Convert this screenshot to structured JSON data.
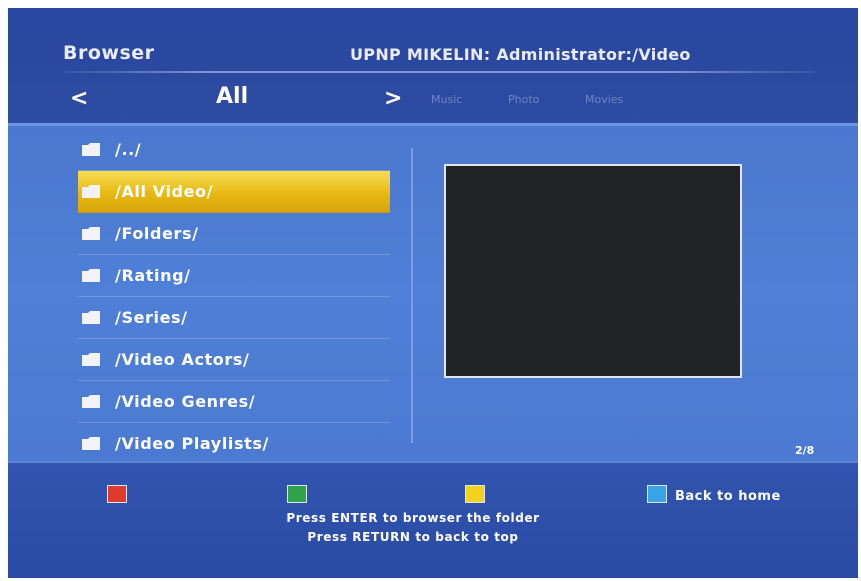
{
  "header": {
    "title": "Browser",
    "server_path": "UPNP  MIKELIN: Administrator:/Video",
    "nav_prev": "<",
    "nav_current": "All",
    "nav_next": ">",
    "categories": [
      "Music",
      "Photo",
      "Movies"
    ]
  },
  "list": {
    "items": [
      {
        "label": "/../",
        "icon": "folder-icon",
        "selected": false
      },
      {
        "label": "/All Video/",
        "icon": "folder-icon",
        "selected": true
      },
      {
        "label": "/Folders/",
        "icon": "folder-icon",
        "selected": false
      },
      {
        "label": "/Rating/",
        "icon": "folder-icon",
        "selected": false
      },
      {
        "label": "/Series/",
        "icon": "folder-icon",
        "selected": false
      },
      {
        "label": "/Video Actors/",
        "icon": "folder-icon",
        "selected": false
      },
      {
        "label": "/Video Genres/",
        "icon": "folder-icon",
        "selected": false
      },
      {
        "label": "/Video Playlists/",
        "icon": "folder-icon",
        "selected": false
      }
    ],
    "page_indicator": "2/8"
  },
  "footer": {
    "color_keys": [
      {
        "color": "#e03a2c",
        "label": ""
      },
      {
        "color": "#30a34a",
        "label": ""
      },
      {
        "color": "#f2d21d",
        "label": ""
      },
      {
        "color": "#39a5e6",
        "label": "Back to home"
      }
    ],
    "hint_enter": "Press ENTER to browser the folder",
    "hint_return": "Press RETURN to back to top"
  },
  "colors": {
    "header_bg": "#2b499f",
    "content_bg": "#4f7fd6",
    "selection": "#e8b914",
    "preview_bg": "#222326"
  }
}
